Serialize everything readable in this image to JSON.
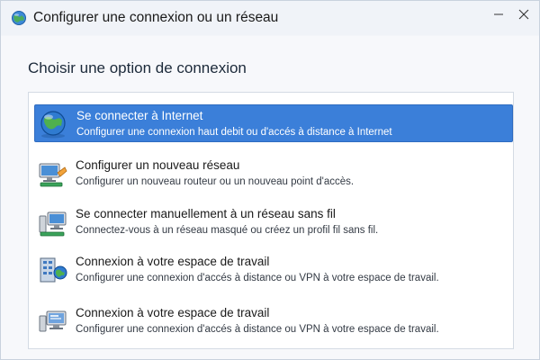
{
  "window": {
    "title": "Configurer une connexion ou un réseau",
    "title_icon": "network-globe-icon",
    "minimize_icon": "minimize-icon",
    "close_icon": "close-icon"
  },
  "main": {
    "heading": "Choisir une option de connexion",
    "options": [
      {
        "title": "Se connecter à Internet",
        "description": "Configurer une connexion haut debit ou d'accés à distance à Internet",
        "icon": "globe-icon",
        "selected": true
      },
      {
        "title": "Configurer un nouveau réseau",
        "description": "Configurer un nouveau routeur ou un nouveau point d'accès.",
        "icon": "new-network-icon",
        "selected": false
      },
      {
        "title": "Se connecter manuellement à un réseau sans fil",
        "description": "Connectez-vous à un réseau masqué ou créez un profil fil sans fil.",
        "icon": "wireless-computer-icon",
        "selected": false
      },
      {
        "title": "Connexion à votre espace de travail",
        "description": "Configurer une connexion d'accés à distance ou VPN à votre espace de travail.",
        "icon": "workplace-building-icon",
        "selected": false
      },
      {
        "title": "Connexion à votre espace de travail",
        "description": "Configurer une connexion d'accés à distance ou VPN à votre espace de travail.",
        "icon": "workplace-monitor-icon",
        "selected": false
      }
    ]
  },
  "colors": {
    "selection": "#3b7fd9",
    "background": "#f7f8fb"
  }
}
